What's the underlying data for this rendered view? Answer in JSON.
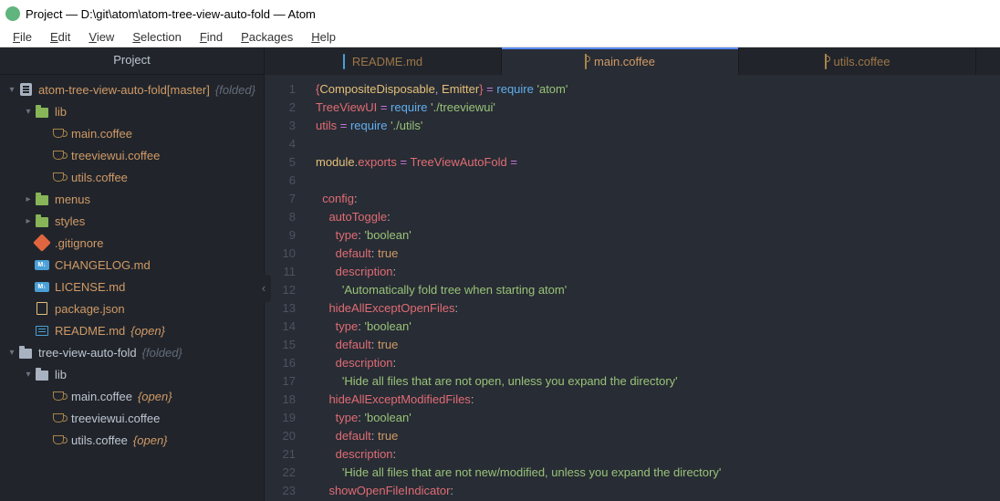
{
  "window": {
    "title": "Project — D:\\git\\atom\\atom-tree-view-auto-fold — Atom"
  },
  "menubar": [
    "File",
    "Edit",
    "View",
    "Selection",
    "Find",
    "Packages",
    "Help"
  ],
  "sidebar": {
    "title": "Project",
    "items": [
      {
        "depth": 0,
        "chev": "▾",
        "icon": "repo",
        "label": "atom-tree-view-auto-fold",
        "branch": "[master]",
        "status": "{folded}",
        "mod": true
      },
      {
        "depth": 1,
        "chev": "▾",
        "icon": "folder",
        "label": "lib",
        "mod": true
      },
      {
        "depth": 2,
        "chev": "",
        "icon": "coffee",
        "label": "main.coffee",
        "mod": true
      },
      {
        "depth": 2,
        "chev": "",
        "icon": "coffee",
        "label": "treeviewui.coffee",
        "mod": true
      },
      {
        "depth": 2,
        "chev": "",
        "icon": "coffee",
        "label": "utils.coffee",
        "mod": true
      },
      {
        "depth": 1,
        "chev": "▸",
        "icon": "folder",
        "label": "menus",
        "mod": true
      },
      {
        "depth": 1,
        "chev": "▸",
        "icon": "folder",
        "label": "styles",
        "mod": true
      },
      {
        "depth": 1,
        "chev": "",
        "icon": "git",
        "label": ".gitignore",
        "mod": true
      },
      {
        "depth": 1,
        "chev": "",
        "icon": "md",
        "label": "CHANGELOG.md",
        "mod": true
      },
      {
        "depth": 1,
        "chev": "",
        "icon": "md",
        "label": "LICENSE.md",
        "mod": true
      },
      {
        "depth": 1,
        "chev": "",
        "icon": "json",
        "label": "package.json",
        "mod": true
      },
      {
        "depth": 1,
        "chev": "",
        "icon": "readme",
        "label": "README.md",
        "statusmod": "{open}",
        "mod": true
      },
      {
        "depth": 0,
        "chev": "▾",
        "icon": "foldergrey",
        "label": "tree-view-auto-fold",
        "status": "{folded}"
      },
      {
        "depth": 1,
        "chev": "▾",
        "icon": "foldergrey",
        "label": "lib"
      },
      {
        "depth": 2,
        "chev": "",
        "icon": "coffee",
        "label": "main.coffee",
        "statusmod": "{open}"
      },
      {
        "depth": 2,
        "chev": "",
        "icon": "coffee",
        "label": "treeviewui.coffee"
      },
      {
        "depth": 2,
        "chev": "",
        "icon": "coffee",
        "label": "utils.coffee",
        "statusmod": "{open}"
      }
    ]
  },
  "tabs": [
    {
      "icon": "readme",
      "label": "README.md",
      "mod": true
    },
    {
      "icon": "coffee",
      "label": "main.coffee",
      "active": true,
      "mod": true
    },
    {
      "icon": "coffee",
      "label": "utils.coffee",
      "mod": true
    }
  ],
  "code": {
    "first_line": 1,
    "lines": [
      [
        [
          "r",
          "{"
        ],
        [
          "y",
          "CompositeDisposable"
        ],
        [
          "w",
          ", "
        ],
        [
          "y",
          "Emitter"
        ],
        [
          "r",
          "}"
        ],
        [
          "w",
          " "
        ],
        [
          "p",
          "="
        ],
        [
          "w",
          " "
        ],
        [
          "b",
          "require"
        ],
        [
          "w",
          " "
        ],
        [
          "g",
          "'atom'"
        ]
      ],
      [
        [
          "r",
          "TreeViewUI"
        ],
        [
          "w",
          " "
        ],
        [
          "p",
          "="
        ],
        [
          "w",
          " "
        ],
        [
          "b",
          "require"
        ],
        [
          "w",
          " "
        ],
        [
          "g",
          "'./treeviewui'"
        ]
      ],
      [
        [
          "r",
          "utils"
        ],
        [
          "w",
          " "
        ],
        [
          "p",
          "="
        ],
        [
          "w",
          " "
        ],
        [
          "b",
          "require"
        ],
        [
          "w",
          " "
        ],
        [
          "g",
          "'./utils'"
        ]
      ],
      [],
      [
        [
          "y",
          "module"
        ],
        [
          "w",
          "."
        ],
        [
          "r",
          "exports"
        ],
        [
          "w",
          " "
        ],
        [
          "p",
          "="
        ],
        [
          "w",
          " "
        ],
        [
          "r",
          "TreeViewAutoFold"
        ],
        [
          "w",
          " "
        ],
        [
          "p",
          "="
        ]
      ],
      [],
      [
        [
          "w",
          "  "
        ],
        [
          "r",
          "config"
        ],
        [
          "w",
          ":"
        ]
      ],
      [
        [
          "w",
          "    "
        ],
        [
          "r",
          "autoToggle"
        ],
        [
          "w",
          ":"
        ]
      ],
      [
        [
          "w",
          "      "
        ],
        [
          "r",
          "type"
        ],
        [
          "w",
          ": "
        ],
        [
          "g",
          "'boolean'"
        ]
      ],
      [
        [
          "w",
          "      "
        ],
        [
          "r",
          "default"
        ],
        [
          "w",
          ": "
        ],
        [
          "o",
          "true"
        ]
      ],
      [
        [
          "w",
          "      "
        ],
        [
          "r",
          "description"
        ],
        [
          "w",
          ":"
        ]
      ],
      [
        [
          "w",
          "        "
        ],
        [
          "g",
          "'Automatically fold tree when starting atom'"
        ]
      ],
      [
        [
          "w",
          "    "
        ],
        [
          "r",
          "hideAllExceptOpenFiles"
        ],
        [
          "w",
          ":"
        ]
      ],
      [
        [
          "w",
          "      "
        ],
        [
          "r",
          "type"
        ],
        [
          "w",
          ": "
        ],
        [
          "g",
          "'boolean'"
        ]
      ],
      [
        [
          "w",
          "      "
        ],
        [
          "r",
          "default"
        ],
        [
          "w",
          ": "
        ],
        [
          "o",
          "true"
        ]
      ],
      [
        [
          "w",
          "      "
        ],
        [
          "r",
          "description"
        ],
        [
          "w",
          ":"
        ]
      ],
      [
        [
          "w",
          "        "
        ],
        [
          "g",
          "'Hide all files that are not open, unless you expand the directory'"
        ]
      ],
      [
        [
          "w",
          "    "
        ],
        [
          "r",
          "hideAllExceptModifiedFiles"
        ],
        [
          "w",
          ":"
        ]
      ],
      [
        [
          "w",
          "      "
        ],
        [
          "r",
          "type"
        ],
        [
          "w",
          ": "
        ],
        [
          "g",
          "'boolean'"
        ]
      ],
      [
        [
          "w",
          "      "
        ],
        [
          "r",
          "default"
        ],
        [
          "w",
          ": "
        ],
        [
          "o",
          "true"
        ]
      ],
      [
        [
          "w",
          "      "
        ],
        [
          "r",
          "description"
        ],
        [
          "w",
          ":"
        ]
      ],
      [
        [
          "w",
          "        "
        ],
        [
          "g",
          "'Hide all files that are not new/modified, unless you expand the directory'"
        ]
      ],
      [
        [
          "w",
          "    "
        ],
        [
          "r",
          "showOpenFileIndicator"
        ],
        [
          "w",
          ":"
        ]
      ]
    ]
  }
}
